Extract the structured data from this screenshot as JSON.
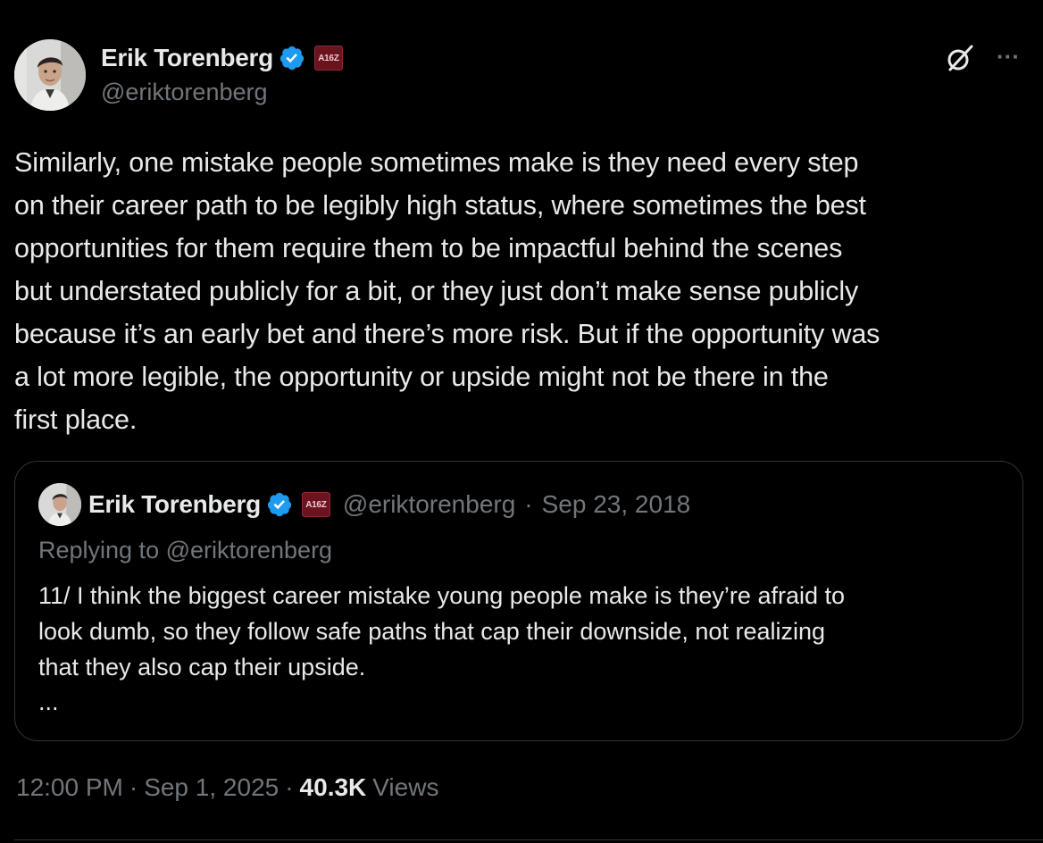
{
  "author": {
    "name": "Erik Torenberg",
    "handle": "@eriktorenberg",
    "affiliation_badge": "A16Z"
  },
  "tweet": {
    "text": "Similarly, one mistake people sometimes make is they need every step\non their career path to be legibly high status, where sometimes the best\nopportunities for them require them to be impactful behind the scenes\nbut understated publicly for a bit, or they just don’t make sense publicly\nbecause it’s an early bet and there’s more risk. But if the opportunity was\na lot more legible, the opportunity or upside might not be there in the\nfirst place."
  },
  "quote": {
    "name": "Erik Torenberg",
    "handle": "@eriktorenberg",
    "separator": "·",
    "date": "Sep 23, 2018",
    "replying_to": "Replying to @eriktorenberg",
    "text": "11/ I think the biggest career mistake young people make is they’re afraid to\nlook dumb, so they follow safe paths that cap their downside, not realizing\nthat they also cap their upside.",
    "ellipsis": "..."
  },
  "footer": {
    "time": "12:00 PM",
    "sep1": "·",
    "date": "Sep 1, 2025",
    "sep2": "·",
    "views_count": "40.3K",
    "views_label": "Views"
  },
  "icons": {
    "verified": "verified-badge-icon",
    "grok": "grok-icon",
    "more": "more-options-icon"
  },
  "colors": {
    "background": "#000000",
    "text_primary": "#e7e9ea",
    "text_secondary": "#71767b",
    "verified_blue": "#1d9bf0",
    "border": "#2f3336",
    "badge_red": "#6b1420"
  }
}
